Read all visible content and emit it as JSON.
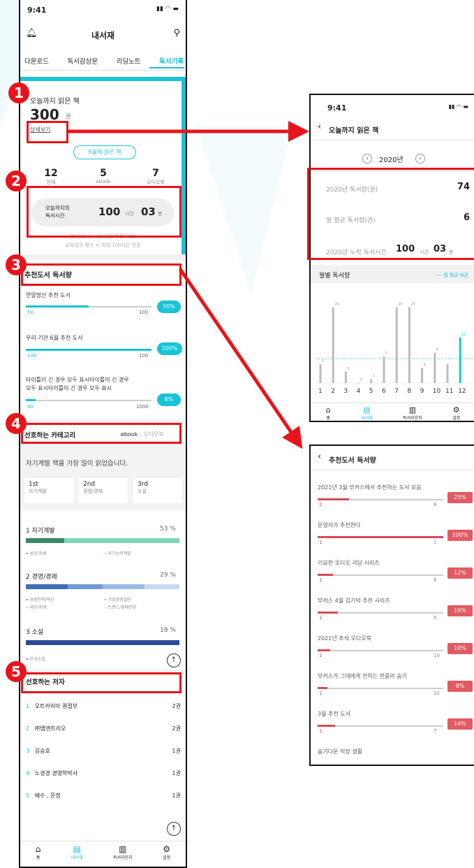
{
  "left": {
    "status_time": "9:41",
    "header_title": "내서재",
    "tabs": [
      "다운로드",
      "독서감상문",
      "리딩노트",
      "독서기록"
    ],
    "read_books": {
      "title": "오늘까지 읽은 책",
      "count": "300",
      "unit": "권",
      "detail_link": "상세보기",
      "month_button": "6월에 읽은 책"
    },
    "stats": [
      {
        "value": "12",
        "label": "전체"
      },
      {
        "value": "5",
        "label": "ebook"
      },
      {
        "value": "7",
        "label": "오디오북"
      }
    ],
    "reading_time": {
      "label_1": "오늘까지의",
      "label_2": "독서시간",
      "hours": "100",
      "hours_unit": "시간",
      "minutes": "03",
      "minutes_unit": "분"
    },
    "reading_note": {
      "line1": "회 교육 시 시간 인정(예정/기준)",
      "line2": "교육성과 평가 시 최대 100시간 인정"
    },
    "recommend": {
      "title": "추천도서 독서량",
      "items": [
        {
          "name": "연말정산 추천 도서",
          "left": "50",
          "right": "100",
          "percent": "50%",
          "fill": 0.5
        },
        {
          "name": "우리 기관 6월 추천 도서",
          "left": "100",
          "right": "100",
          "percent": "100%",
          "fill": 1.0
        },
        {
          "name1": "타이틀이 긴 경우 모두 표시타이틀이 긴 경우",
          "name2": "모두 표시타이틀이 긴 경우 모두 표시",
          "left": "80",
          "right": "1000",
          "percent": "8%",
          "fill": 0.08
        }
      ]
    },
    "category": {
      "title": "선호하는 카테고리",
      "toggle_ebook": "ebook",
      "toggle_audio": "오디오북",
      "summary": "자기계발 책을 가장 많이 읽었습니다.",
      "ranks": [
        {
          "rank": "1st",
          "name": "자기계발"
        },
        {
          "rank": "2nd",
          "name": "경영/경제"
        },
        {
          "rank": "3rd",
          "name": "소설"
        }
      ],
      "groups": [
        {
          "label": "1  자기계발",
          "percent": "53 %",
          "legend": [
            "성공/처세",
            "자기능력계발"
          ]
        },
        {
          "label": "2  경영/경제",
          "percent": "29 %",
          "legend": [
            "경영전략/혁신",
            "기업경영일반",
            "세무/회계",
            "트렌드/경제전망"
          ]
        },
        {
          "label": "3  소설",
          "percent": "18 %",
          "legend": [
            "한국소설"
          ]
        }
      ]
    },
    "authors": {
      "title": "선호하는 저자",
      "list": [
        {
          "no": "1",
          "name": "오트카리아 퀀컬부",
          "count": "2권"
        },
        {
          "no": "2",
          "name": "㈜엠엔트리오",
          "count": "2권"
        },
        {
          "no": "3",
          "name": "김승호",
          "count": "1권"
        },
        {
          "no": "4",
          "name": "노경경 경영학박사",
          "count": "1권"
        },
        {
          "no": "5",
          "name": "배수 , 문정",
          "count": "1권"
        }
      ]
    },
    "bottom_nav": [
      {
        "label": "홈"
      },
      {
        "label": "내서재"
      },
      {
        "label": "독서라운지"
      },
      {
        "label": "설정"
      }
    ]
  },
  "right_top": {
    "status_time": "9:41",
    "title": "오늘까지 읽은 책",
    "year": "2020년",
    "rows": [
      {
        "label": "2020년 독서량(권)",
        "value": "74"
      },
      {
        "label": "월 평균 독서량(권)",
        "value": "6"
      },
      {
        "label": "2020년 누적 독서시간",
        "hours": "100",
        "hours_unit": "시간",
        "minutes": "03",
        "minutes_unit": "분"
      }
    ],
    "monthly_title": "월별 독서량",
    "legend": "월 평균 N권",
    "chart_data": {
      "type": "bar",
      "categories": [
        "1",
        "2",
        "3",
        "4",
        "5",
        "6",
        "7",
        "8",
        "9",
        "10",
        "11",
        "12"
      ],
      "values": [
        5,
        20,
        3,
        0,
        1,
        7,
        20,
        20,
        4,
        8,
        5,
        12
      ],
      "data_labels": [
        "5",
        "20",
        "3",
        "0",
        "1",
        "7",
        "20",
        "20",
        "4",
        "8",
        "",
        "12"
      ],
      "highlight_index": 11
    },
    "bottom_nav": [
      {
        "label": "홈"
      },
      {
        "label": "내서재"
      },
      {
        "label": "독서라운지"
      },
      {
        "label": "설정"
      }
    ]
  },
  "right_bottom": {
    "title": "추천도서 독서량",
    "items": [
      {
        "name": "2021년 3월 부커스에서 추천하는 도서 모음",
        "left": "2",
        "right": "8",
        "percent": "25%",
        "fill": 0.25
      },
      {
        "name": "운영자가 추천한다",
        "left": "1",
        "right": "1",
        "percent": "100%",
        "fill": 1.0
      },
      {
        "name": "기묘한 오디오 괴담 시리즈",
        "left": "1",
        "right": "8",
        "percent": "12%",
        "fill": 0.12
      },
      {
        "name": "부커스 4월 김기덕 추천 시리즈",
        "left": "1",
        "right": "6",
        "percent": "16%",
        "fill": 0.16
      },
      {
        "name": "2021년 추석 오디오북",
        "left": "1",
        "right": "10",
        "percent": "10%",
        "fill": 0.1
      },
      {
        "name": "부커스가 그대에게 전하는 한줌의 숨기",
        "left": "1",
        "right": "12",
        "percent": "8%",
        "fill": 0.08
      },
      {
        "name": "3월 추천 도서",
        "left": "1",
        "right": "7",
        "percent": "14%",
        "fill": 0.14
      },
      {
        "name": "숨기다운 직장 생활"
      }
    ]
  },
  "badges": [
    "1",
    "2",
    "3",
    "4",
    "5"
  ],
  "colors": {
    "accent": "#18c3d6",
    "red": "#e8141b",
    "cat1": "#6fcf97",
    "cat2": "#3f6fb5",
    "cat3": "#2e4a9a"
  }
}
